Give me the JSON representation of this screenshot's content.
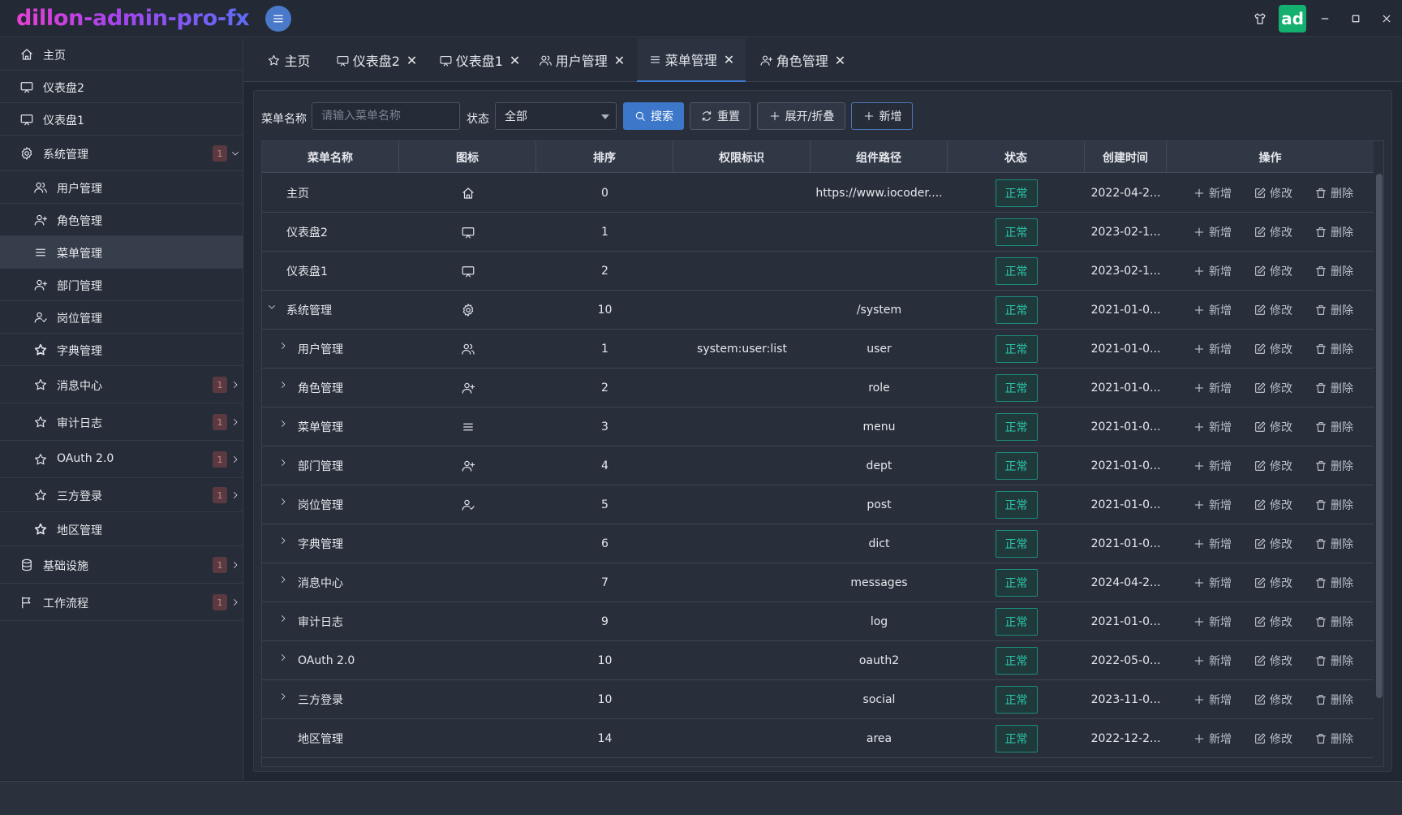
{
  "app": {
    "title": "dillon-admin-pro-fx",
    "avatar_text": "ad"
  },
  "icons": {
    "menu_toggle": "hamburger-icon",
    "skin": "tshirt-icon",
    "minimize": "minimize-icon",
    "maximize": "maximize-icon",
    "close": "close-icon"
  },
  "colors": {
    "accent": "#3c77c9",
    "avatar": "#14b06f",
    "status": "#2bc4a9"
  },
  "sidebar": {
    "items": [
      {
        "label": "主页",
        "icon": "home-icon"
      },
      {
        "label": "仪表盘2",
        "icon": "monitor-icon"
      },
      {
        "label": "仪表盘1",
        "icon": "monitor-icon"
      },
      {
        "label": "系统管理",
        "icon": "gear-icon",
        "badge": "1"
      },
      {
        "label": "用户管理",
        "icon": "users-icon"
      },
      {
        "label": "角色管理",
        "icon": "user-plus-icon"
      },
      {
        "label": "菜单管理",
        "icon": "list-icon",
        "selected": true
      },
      {
        "label": "部门管理",
        "icon": "user-plus-icon"
      },
      {
        "label": "岗位管理",
        "icon": "user-check-icon"
      },
      {
        "label": "字典管理",
        "icon": "star-filled-icon"
      },
      {
        "label": "消息中心",
        "icon": "star-icon",
        "badge": "1"
      },
      {
        "label": "审计日志",
        "icon": "star-icon",
        "badge": "1"
      },
      {
        "label": "OAuth 2.0",
        "icon": "star-icon",
        "badge": "1"
      },
      {
        "label": "三方登录",
        "icon": "star-icon",
        "badge": "1"
      },
      {
        "label": "地区管理",
        "icon": "star-filled-icon"
      },
      {
        "label": "基础设施",
        "icon": "database-icon",
        "badge": "1"
      },
      {
        "label": "工作流程",
        "icon": "flag-icon",
        "badge": "1"
      }
    ]
  },
  "tabs": [
    {
      "label": "主页",
      "icon": "star-icon",
      "closable": false
    },
    {
      "label": "仪表盘2",
      "icon": "monitor-icon",
      "closable": true
    },
    {
      "label": "仪表盘1",
      "icon": "monitor-icon",
      "closable": true
    },
    {
      "label": "用户管理",
      "icon": "users-icon",
      "closable": true
    },
    {
      "label": "菜单管理",
      "icon": "list-icon",
      "closable": true,
      "active": true
    },
    {
      "label": "角色管理",
      "icon": "user-plus-icon",
      "closable": true
    }
  ],
  "tab_close_glyph": "✕",
  "filters": {
    "name_label": "菜单名称",
    "name_placeholder": "请输入菜单名称",
    "status_label": "状态",
    "status_value": "全部",
    "search_button": "搜索",
    "reset_button": "重置",
    "toggle_button": "展开/折叠",
    "add_button": "新增"
  },
  "table": {
    "columns": [
      "菜单名称",
      "图标",
      "排序",
      "权限标识",
      "组件路径",
      "状态",
      "创建时间",
      "操作"
    ],
    "actions": {
      "add": "新增",
      "edit": "修改",
      "delete": "删除"
    },
    "rows": [
      {
        "name": "主页",
        "icon": "home-icon",
        "sort": "0",
        "perm": "",
        "path": "https://www.iocoder....",
        "status": "正常",
        "created": "2022-04-2...",
        "expander": "none"
      },
      {
        "name": "仪表盘2",
        "icon": "monitor-icon",
        "sort": "1",
        "perm": "",
        "path": "",
        "status": "正常",
        "created": "2023-02-1...",
        "expander": "none"
      },
      {
        "name": "仪表盘1",
        "icon": "monitor-icon",
        "sort": "2",
        "perm": "",
        "path": "",
        "status": "正常",
        "created": "2023-02-1...",
        "expander": "none"
      },
      {
        "name": "系统管理",
        "icon": "gear-icon",
        "sort": "10",
        "perm": "",
        "path": "/system",
        "status": "正常",
        "created": "2021-01-0...",
        "expander": "expanded"
      },
      {
        "name": "用户管理",
        "icon": "users-icon",
        "sort": "1",
        "perm": "system:user:list",
        "path": "user",
        "status": "正常",
        "created": "2021-01-0...",
        "expander": "collapsed"
      },
      {
        "name": "角色管理",
        "icon": "user-plus-icon",
        "sort": "2",
        "perm": "",
        "path": "role",
        "status": "正常",
        "created": "2021-01-0...",
        "expander": "collapsed"
      },
      {
        "name": "菜单管理",
        "icon": "list-icon",
        "sort": "3",
        "perm": "",
        "path": "menu",
        "status": "正常",
        "created": "2021-01-0...",
        "expander": "collapsed"
      },
      {
        "name": "部门管理",
        "icon": "user-plus-icon",
        "sort": "4",
        "perm": "",
        "path": "dept",
        "status": "正常",
        "created": "2021-01-0...",
        "expander": "collapsed"
      },
      {
        "name": "岗位管理",
        "icon": "user-check-icon",
        "sort": "5",
        "perm": "",
        "path": "post",
        "status": "正常",
        "created": "2021-01-0...",
        "expander": "collapsed"
      },
      {
        "name": "字典管理",
        "icon": "",
        "sort": "6",
        "perm": "",
        "path": "dict",
        "status": "正常",
        "created": "2021-01-0...",
        "expander": "collapsed"
      },
      {
        "name": "消息中心",
        "icon": "",
        "sort": "7",
        "perm": "",
        "path": "messages",
        "status": "正常",
        "created": "2024-04-2...",
        "expander": "collapsed"
      },
      {
        "name": "审计日志",
        "icon": "",
        "sort": "9",
        "perm": "",
        "path": "log",
        "status": "正常",
        "created": "2021-01-0...",
        "expander": "collapsed"
      },
      {
        "name": "OAuth 2.0",
        "icon": "",
        "sort": "10",
        "perm": "",
        "path": "oauth2",
        "status": "正常",
        "created": "2022-05-0...",
        "expander": "collapsed"
      },
      {
        "name": "三方登录",
        "icon": "",
        "sort": "10",
        "perm": "",
        "path": "social",
        "status": "正常",
        "created": "2023-11-0...",
        "expander": "collapsed"
      },
      {
        "name": "地区管理",
        "icon": "",
        "sort": "14",
        "perm": "",
        "path": "area",
        "status": "正常",
        "created": "2022-12-2...",
        "expander": "none"
      }
    ]
  }
}
